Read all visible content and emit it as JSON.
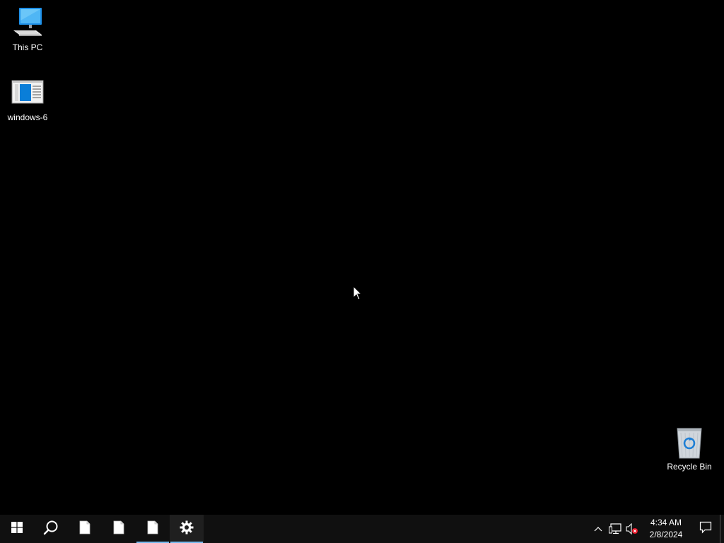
{
  "desktop": {
    "background_color": "#000000",
    "icons": [
      {
        "label": "This PC",
        "icon": "computer-icon"
      },
      {
        "label": "windows-6",
        "icon": "document-window-icon"
      },
      {
        "label": "Recycle Bin",
        "icon": "recycle-bin-icon"
      }
    ]
  },
  "taskbar": {
    "background_color": "#101010",
    "accent_color": "#76b9ed",
    "buttons": [
      {
        "name": "start-button",
        "icon": "windows-logo-icon"
      },
      {
        "name": "search-button",
        "icon": "search-icon"
      },
      {
        "name": "taskbar-file-1",
        "icon": "blank-file-icon"
      },
      {
        "name": "taskbar-file-2",
        "icon": "blank-file-icon"
      },
      {
        "name": "taskbar-file-3",
        "icon": "blank-file-icon",
        "active": true
      },
      {
        "name": "taskbar-settings",
        "icon": "gear-icon",
        "active": true
      }
    ],
    "tray": {
      "icons": [
        "chevron-up-icon",
        "network-icon",
        "volume-muted-icon"
      ],
      "time": "4:34 AM",
      "date": "2/8/2024",
      "notification_icon": "action-center-icon"
    }
  }
}
